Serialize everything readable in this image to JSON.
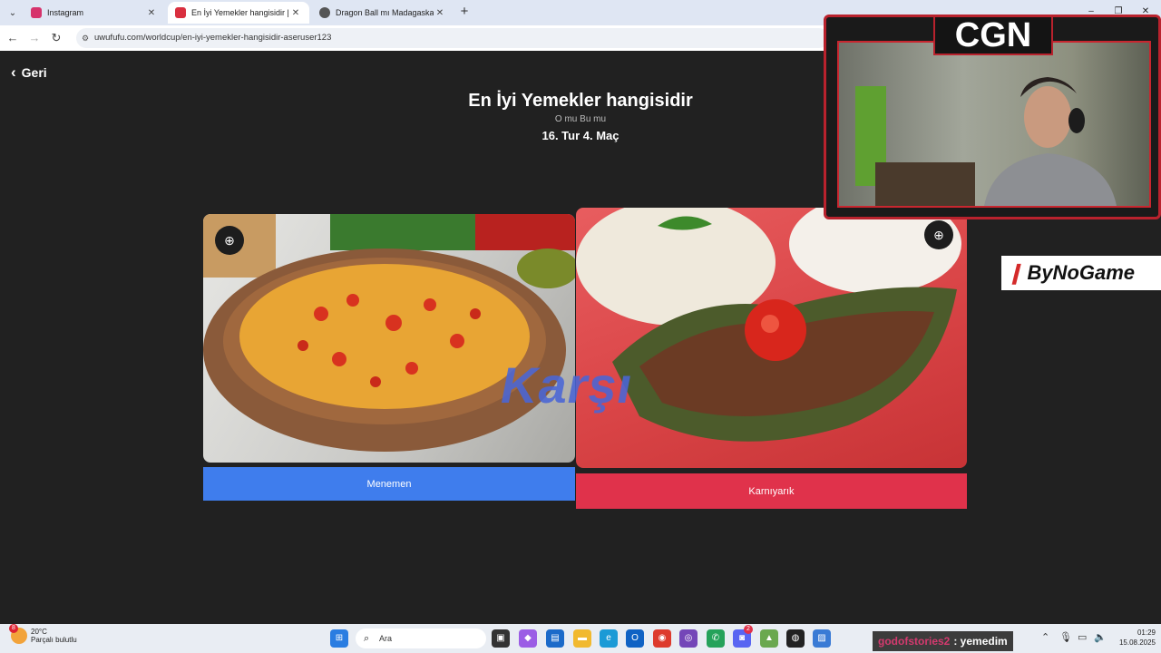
{
  "browser": {
    "tabs": [
      {
        "title": "Instagram",
        "active": false
      },
      {
        "title": "En İyi Yemekler hangisidir | Uwu",
        "active": true
      },
      {
        "title": "Dragon Ball mı Madagaskar mı",
        "active": false
      }
    ],
    "url": "uwufufu.com/worldcup/en-iyi-yemekler-hangisidir-aseruser123"
  },
  "page": {
    "back_label": "Geri",
    "title": "En İyi Yemekler hangisidir",
    "subtitle": "O mu Bu mu",
    "round": "16. Tur 4. Maç",
    "versus_text": "Karşı",
    "options": [
      {
        "label": "Menemen",
        "color": "#3f7ded"
      },
      {
        "label": "Karnıyarık",
        "color": "#e0324b"
      }
    ]
  },
  "overlay": {
    "cam_logo": "CGN",
    "sponsor": "ByNoGame",
    "chat_user": "godofstories2",
    "chat_message": ": yemedim"
  },
  "taskbar": {
    "weather_badge": "8",
    "weather_temp": "20°C",
    "weather_desc": "Parçalı bulutlu",
    "search_placeholder": "Ara",
    "discord_badge": "2",
    "time": "01:29",
    "date": "15.08.2025"
  },
  "colors": {
    "page_bg": "#212121",
    "left_choice": "#3f7ded",
    "right_choice": "#e0324b",
    "frame_red": "#b9222d"
  }
}
